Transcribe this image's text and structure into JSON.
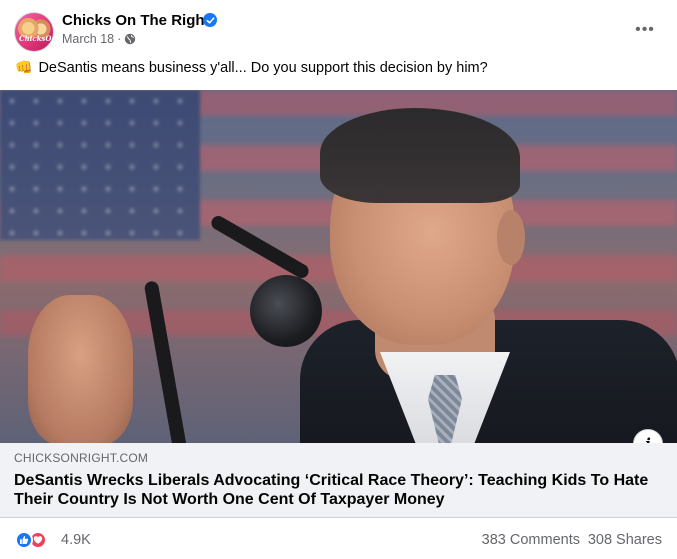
{
  "post": {
    "page_name": "Chicks On The Right",
    "avatar_text": "ChicksOnTheRight",
    "date": "March 18",
    "separator": "·",
    "audience_icon": "globe-icon",
    "verified_icon": "verified-badge-icon",
    "more_label": "•••",
    "caption_emoji": "👊",
    "caption": "DeSantis means business y'all... Do you support this decision by him?"
  },
  "link_preview": {
    "domain": "CHICKSONRIGHT.COM",
    "title": "DeSantis Wrecks Liberals Advocating ‘Critical Race Theory’: Teaching Kids To Hate Their Country Is Not Worth One Cent Of Taxpayer Money",
    "info_label": "i"
  },
  "engagement": {
    "reaction_count": "4.9K",
    "comments": "383 Comments",
    "shares": "308 Shares",
    "reaction_icons": [
      "like-icon",
      "love-icon"
    ]
  },
  "colors": {
    "accent": "#1877f2",
    "love": "#f33e58",
    "secondary_text": "#65676b",
    "link_box_bg": "#f0f2f5"
  }
}
